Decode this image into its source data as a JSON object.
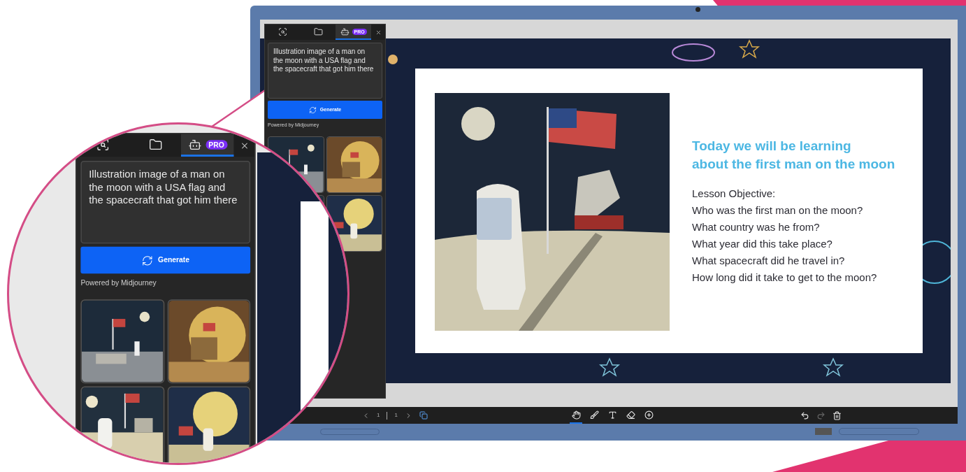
{
  "panel": {
    "tabs": [
      {
        "kind": "image-search",
        "selected": false
      },
      {
        "kind": "folder",
        "selected": false
      },
      {
        "kind": "ai",
        "selected": true,
        "badge": "PRO"
      }
    ],
    "prompt": "Illustration image of a man on the moon with a USA flag and the spacecraft that got him there",
    "button": "Generate",
    "credit": "Powered by Midjourney"
  },
  "magnified_panel": {
    "tabs": [
      {
        "kind": "image-search",
        "selected": false
      },
      {
        "kind": "folder",
        "selected": false
      },
      {
        "kind": "ai",
        "selected": true,
        "badge": "PRO"
      }
    ],
    "prompt": "Illustration image of a man on the moon with a USA flag and the spacecraft that got him there",
    "button": "Generate",
    "credit": "Powered by Midjourney"
  },
  "slide": {
    "title_lines": [
      "Today we will be learning",
      "about the first man on the moon"
    ],
    "lines": [
      "Lesson Objective:",
      "Who was the first man on the moon?",
      "What country was he from?",
      "What year did this take place?",
      "What spacecraft did he travel in?",
      "How long did it take to get to the moon?"
    ]
  },
  "toolbar": {
    "page": "1",
    "total": "1",
    "tools": [
      {
        "kind": "hand",
        "selected": true
      },
      {
        "kind": "pen",
        "selected": false
      },
      {
        "kind": "text",
        "selected": false
      },
      {
        "kind": "eraser",
        "selected": false
      },
      {
        "kind": "add",
        "selected": false
      }
    ],
    "actions": [
      {
        "kind": "undo",
        "disabled": false
      },
      {
        "kind": "redo",
        "disabled": true
      },
      {
        "kind": "delete",
        "disabled": false
      }
    ]
  }
}
